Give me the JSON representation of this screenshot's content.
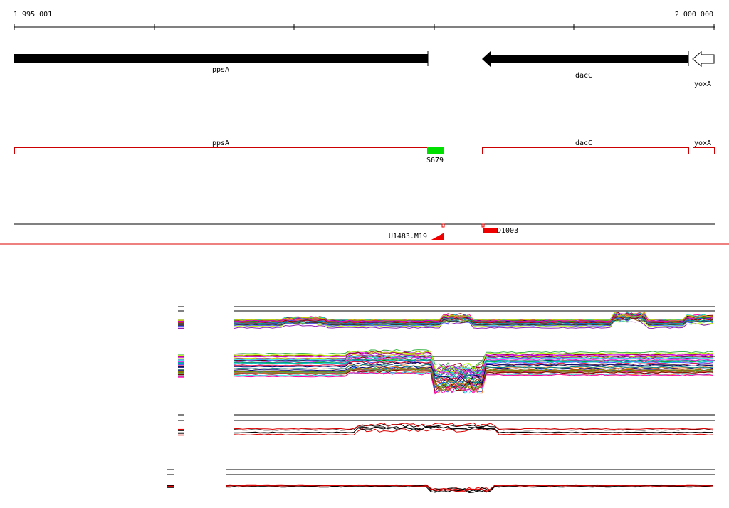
{
  "ruler": {
    "start_label": "1 995 001",
    "end_label": "2 000 000",
    "start": 1995001,
    "end": 2000000
  },
  "genes": [
    {
      "name": "ppsA",
      "start": 1995001,
      "end": 1997950,
      "strand": "+",
      "style": "filled"
    },
    {
      "name": "dacC",
      "start": 1998290,
      "end": 1999740,
      "strand": "-",
      "style": "filled"
    },
    {
      "name": "yoxA",
      "start": 1999745,
      "end": 2000000,
      "strand": "-",
      "style": "outline"
    }
  ],
  "annotation_track": {
    "features": [
      {
        "name": "ppsA",
        "start": 1995001,
        "end": 1997950,
        "color": "#cc0000"
      },
      {
        "name": "dacC",
        "start": 1998290,
        "end": 1999740,
        "color": "#cc0000"
      },
      {
        "name": "yoxA",
        "start": 1999775,
        "end": 2000000,
        "color": "#cc0000"
      }
    ],
    "highlight": {
      "label": "S679",
      "start": 1997950,
      "end": 1998070,
      "color": "#00e000"
    }
  },
  "probe_track": {
    "left_label": "U1483.M19",
    "right_label": "D1003",
    "accent": "#ee0000"
  },
  "colors": {
    "gene_fill": "#000000",
    "divider": "#dd0000"
  }
}
